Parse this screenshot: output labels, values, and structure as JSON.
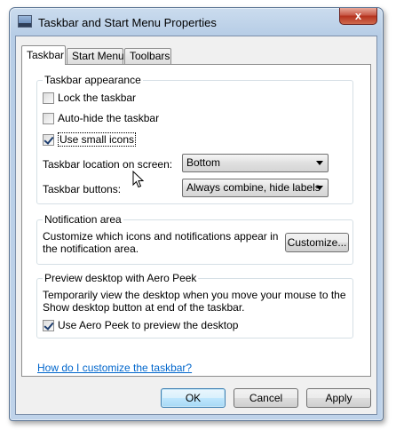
{
  "window": {
    "title": "Taskbar and Start Menu Properties",
    "close_label": "x"
  },
  "tabs": [
    {
      "label": "Taskbar",
      "active": true
    },
    {
      "label": "Start Menu",
      "active": false
    },
    {
      "label": "Toolbars",
      "active": false
    }
  ],
  "taskbar_appearance": {
    "label": "Taskbar appearance",
    "lock": {
      "label": "Lock the taskbar",
      "checked": false
    },
    "autohide": {
      "label": "Auto-hide the taskbar",
      "checked": false
    },
    "small_icons": {
      "label": "Use small icons",
      "checked": true
    },
    "location": {
      "label": "Taskbar location on screen:",
      "value": "Bottom"
    },
    "buttons": {
      "label": "Taskbar buttons:",
      "value": "Always combine, hide labels"
    }
  },
  "notification_area": {
    "label": "Notification area",
    "description": "Customize which icons and notifications appear in the notification area.",
    "customize_label": "Customize..."
  },
  "aero_peek": {
    "label": "Preview desktop with Aero Peek",
    "description": "Temporarily view the desktop when you move your mouse to the Show desktop button at end of the taskbar.",
    "use_peek": {
      "label": "Use Aero Peek to preview the desktop",
      "checked": true
    }
  },
  "help_link": "How do I customize the taskbar?",
  "buttons": {
    "ok": "OK",
    "cancel": "Cancel",
    "apply": "Apply"
  }
}
